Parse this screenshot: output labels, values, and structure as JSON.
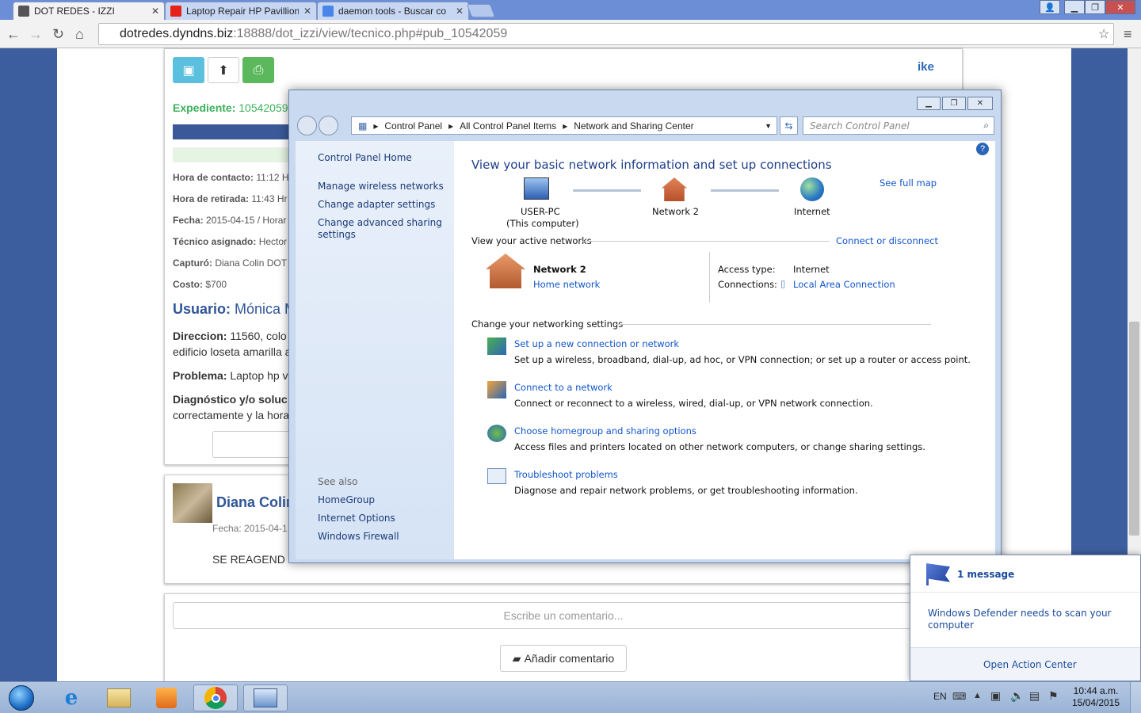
{
  "browser": {
    "tabs": [
      {
        "title": "DOT REDES - IZZI",
        "active": true
      },
      {
        "title": "Laptop Repair HP Pavillion",
        "active": false
      },
      {
        "title": "daemon tools - Buscar co",
        "active": false
      }
    ],
    "url_host": "dotredes.dyndns.biz",
    "url_path": ":18888/dot_izzi/view/tecnico.php#pub_10542059"
  },
  "page": {
    "logo_text": "ike",
    "expediente_label": "Expediente:",
    "expediente_value": "10542059",
    "fields": [
      {
        "label": "Hora de contacto:",
        "value": "11:12 H"
      },
      {
        "label": "Hora de retirada:",
        "value": "11:43 Hr"
      },
      {
        "label": "Fecha:",
        "value": "2015-04-15 / Horar"
      },
      {
        "label": "Técnico asignado:",
        "value": "Hector"
      },
      {
        "label": "Capturó:",
        "value": "Diana Colin DOT"
      },
      {
        "label": "Costo:",
        "value": "$700"
      }
    ],
    "usuario_label": "Usuario:",
    "usuario_value": "Mónica M",
    "direccion_label": "Direccion:",
    "direccion_value": "11560, colo",
    "direccion_line2": "edificio loseta amarilla a",
    "problema_label": "Problema:",
    "problema_value": "Laptop hp v",
    "diagnostico_label": "Diagnóstico y/o soluc",
    "diagnostico_line2": "correctamente y la hora",
    "comment_author": "Diana Colin",
    "comment_date": "Fecha: 2015-04-1",
    "comment_text": "SE REAGEND",
    "comment_placeholder": "Escribe un comentario...",
    "add_comment_label": "Añadir comentario"
  },
  "control_panel": {
    "breadcrumb": [
      "Control Panel",
      "All Control Panel Items",
      "Network and Sharing Center"
    ],
    "search_placeholder": "Search Control Panel",
    "left_links": {
      "home": "Control Panel Home",
      "manage_wireless": "Manage wireless networks",
      "adapter": "Change adapter settings",
      "advanced_1": "Change advanced sharing",
      "advanced_2": "settings"
    },
    "see_also_label": "See also",
    "see_also": [
      "HomeGroup",
      "Internet Options",
      "Windows Firewall"
    ],
    "heading": "View your basic network information and set up connections",
    "see_full_map": "See full map",
    "map": {
      "computer": "USER-PC",
      "computer_sub": "(This computer)",
      "network": "Network  2",
      "internet": "Internet"
    },
    "active_networks_label": "View your active networks",
    "connect_disconnect": "Connect or disconnect",
    "active": {
      "name": "Network  2",
      "type_link": "Home network",
      "access_type_label": "Access type:",
      "access_type_value": "Internet",
      "connections_label": "Connections:",
      "connections_value": "Local Area Connection"
    },
    "change_label": "Change your networking settings",
    "tasks": [
      {
        "title": "Set up a new connection or network",
        "desc": "Set up a wireless, broadband, dial-up, ad hoc, or VPN connection; or set up a router or access point."
      },
      {
        "title": "Connect to a network",
        "desc": "Connect or reconnect to a wireless, wired, dial-up, or VPN network connection."
      },
      {
        "title": "Choose homegroup and sharing options",
        "desc": "Access files and printers located on other network computers, or change sharing settings."
      },
      {
        "title": "Troubleshoot problems",
        "desc": "Diagnose and repair network problems, or get troubleshooting information."
      }
    ]
  },
  "notification": {
    "title": "1 message",
    "body": "Windows Defender needs to scan your computer",
    "action": "Open Action Center"
  },
  "taskbar": {
    "lang": "EN",
    "time": "10:44 a.m.",
    "date": "15/04/2015"
  }
}
